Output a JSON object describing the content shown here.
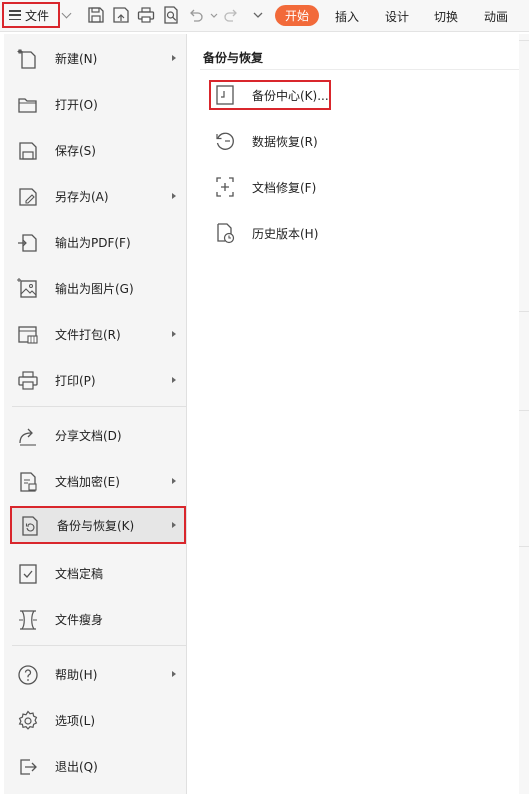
{
  "toolbar": {
    "file_label": "文件",
    "tabs": [
      "开始",
      "插入",
      "设计",
      "切换",
      "动画"
    ]
  },
  "menu": {
    "items": [
      {
        "label": "新建(N)",
        "icon": "new-icon"
      },
      {
        "label": "打开(O)",
        "icon": "folder-icon"
      },
      {
        "label": "保存(S)",
        "icon": "save-icon"
      },
      {
        "label": "另存为(A)",
        "icon": "save-as-icon"
      },
      {
        "label": "输出为PDF(F)",
        "icon": "pdf-export-icon"
      },
      {
        "label": "输出为图片(G)",
        "icon": "image-export-icon"
      },
      {
        "label": "文件打包(R)",
        "icon": "package-icon"
      },
      {
        "label": "打印(P)",
        "icon": "print-icon"
      },
      {
        "label": "分享文档(D)",
        "icon": "share-icon"
      },
      {
        "label": "文档加密(E)",
        "icon": "lock-doc-icon"
      },
      {
        "label": "备份与恢复(K)",
        "icon": "backup-icon"
      },
      {
        "label": "文档定稿",
        "icon": "finalize-icon"
      },
      {
        "label": "文件瘦身",
        "icon": "slim-icon"
      },
      {
        "label": "帮助(H)",
        "icon": "help-icon"
      },
      {
        "label": "选项(L)",
        "icon": "gear-icon"
      },
      {
        "label": "退出(Q)",
        "icon": "exit-icon"
      }
    ]
  },
  "submenu": {
    "title": "备份与恢复",
    "items": [
      {
        "label": "备份中心(K)...",
        "icon": "backup-center-icon"
      },
      {
        "label": "数据恢复(R)",
        "icon": "recover-icon"
      },
      {
        "label": "文档修复(F)",
        "icon": "repair-icon"
      },
      {
        "label": "历史版本(H)",
        "icon": "history-icon"
      }
    ]
  },
  "colors": {
    "accent": "#f26a3a",
    "highlight_border": "#d9262c"
  }
}
